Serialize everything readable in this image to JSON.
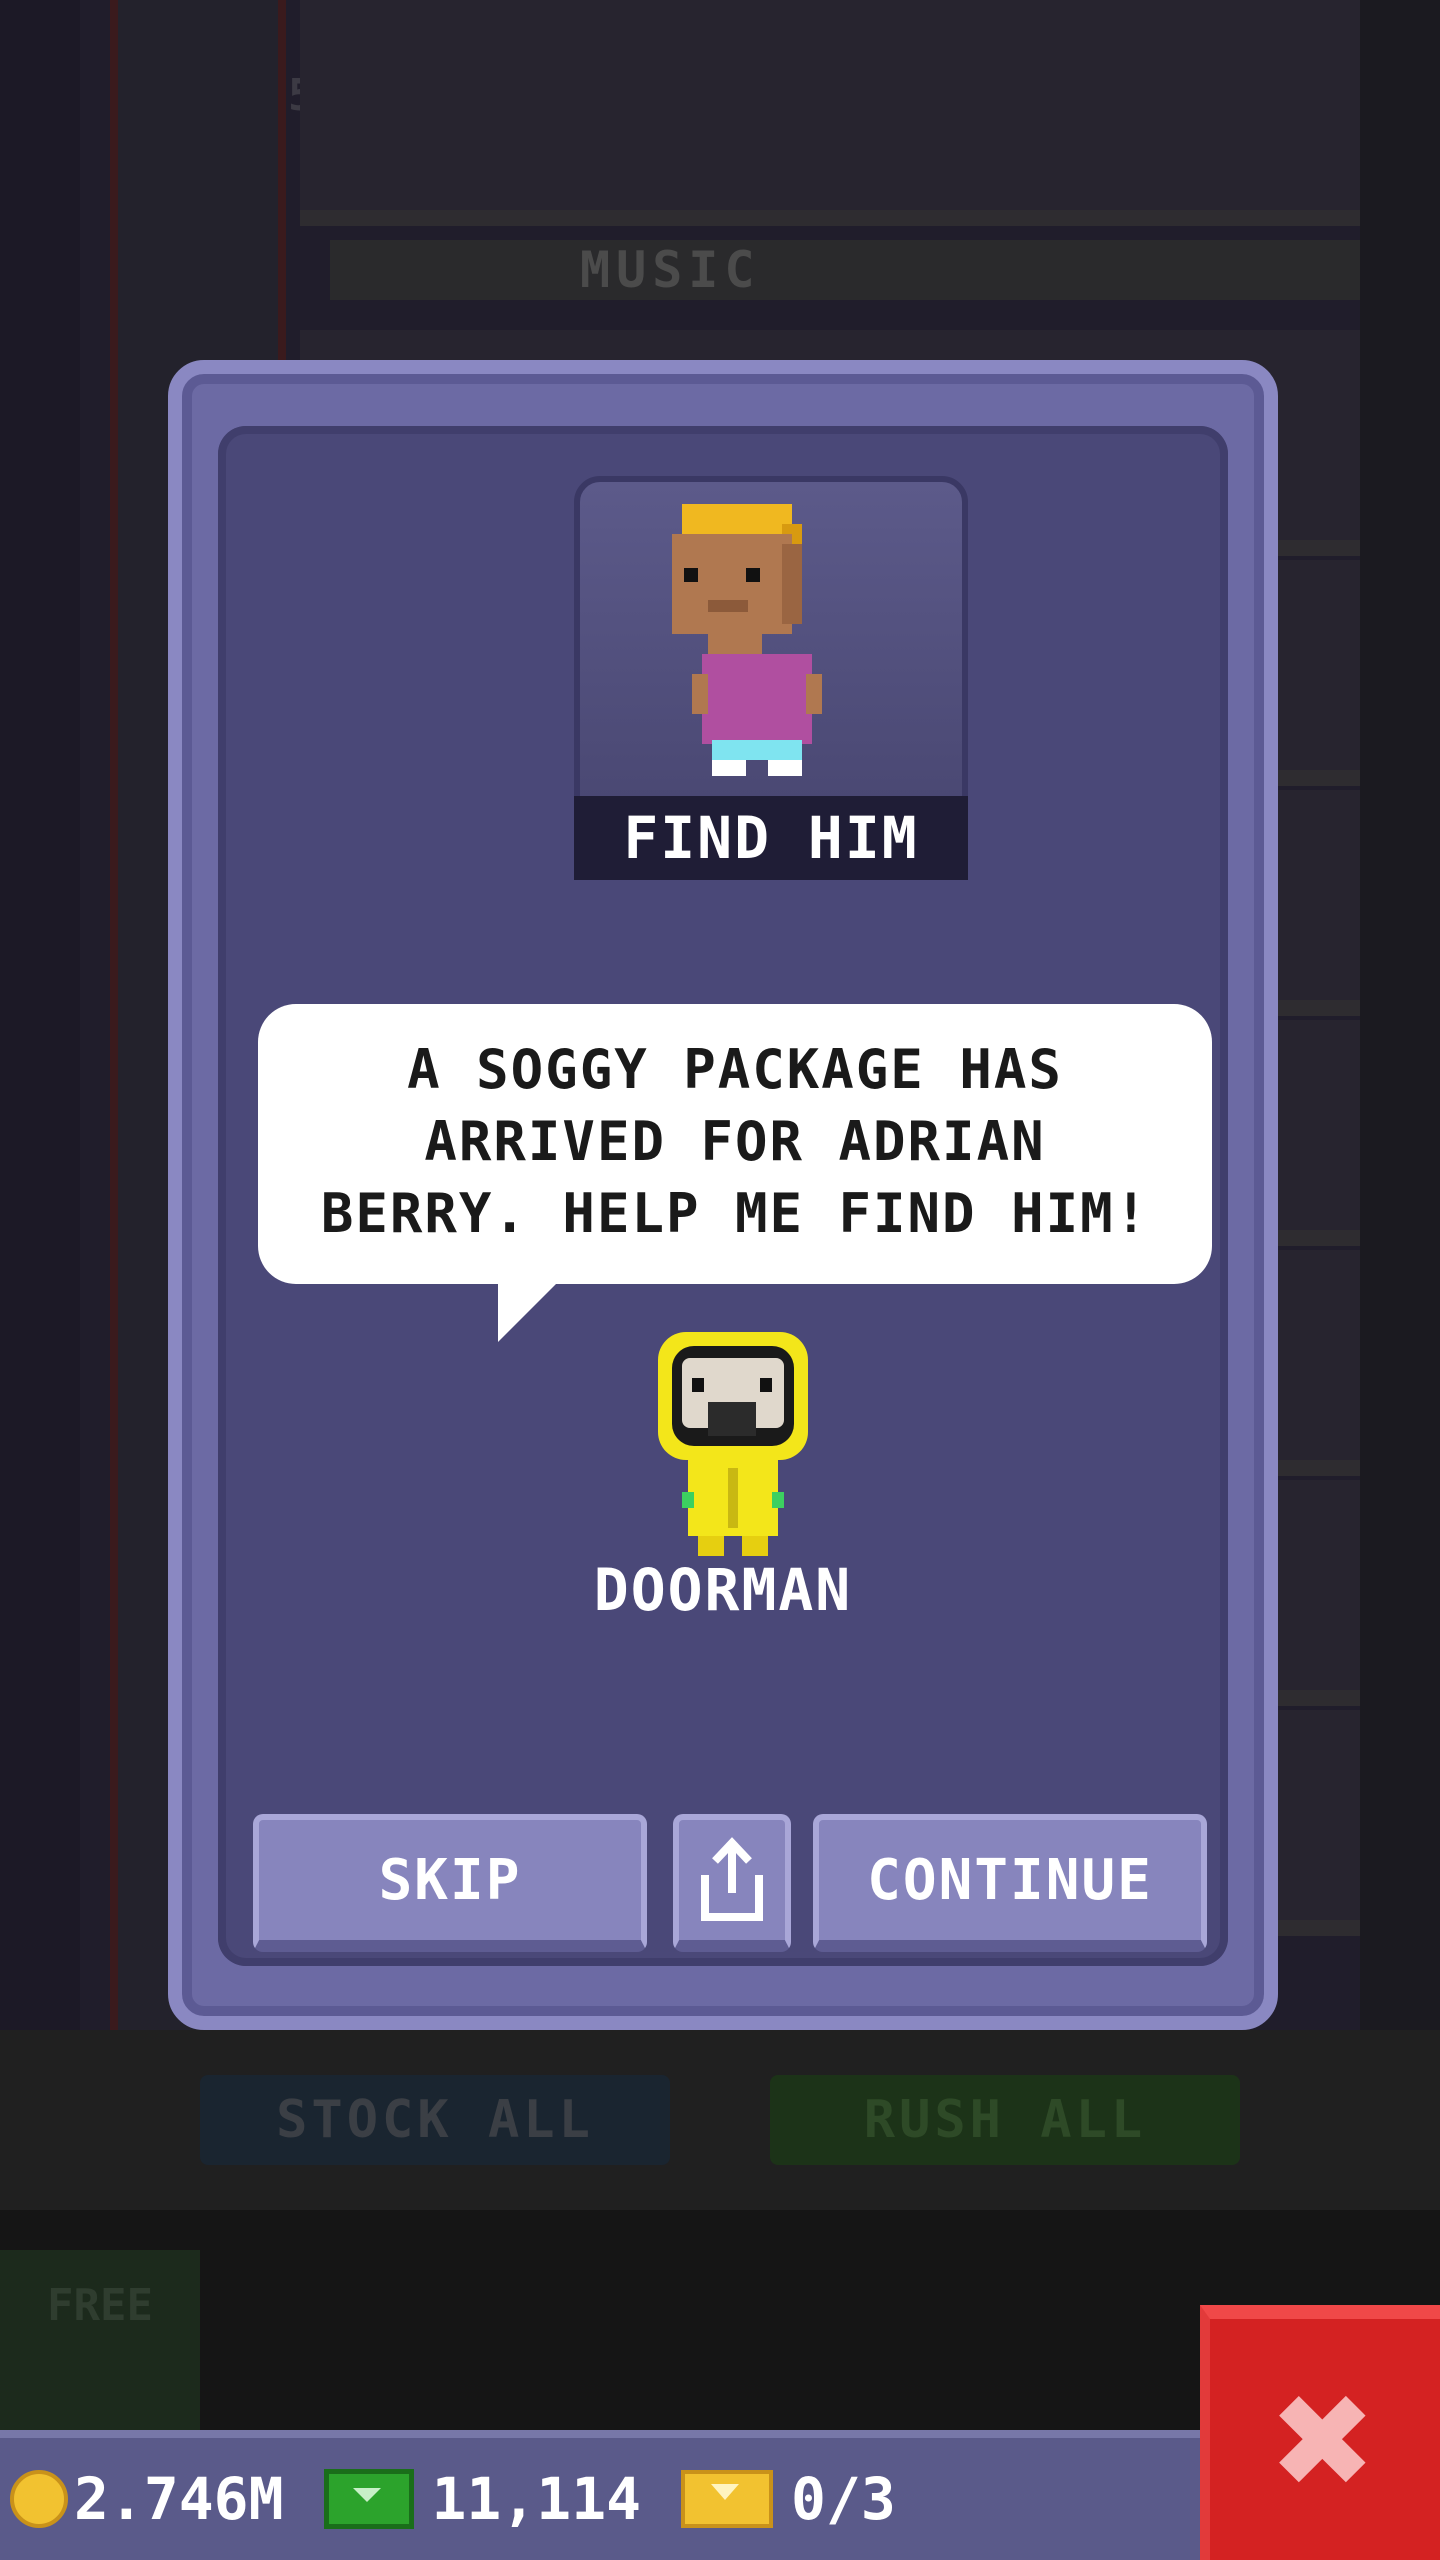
{
  "background": {
    "floor_number": "5",
    "floor_label": "MUSIC",
    "stock_all_label": "STOCK ALL",
    "rush_all_label": "RUSH ALL",
    "free_label": "FREE"
  },
  "dialog": {
    "portrait_label": "FIND HIM",
    "speech_text": "A SOGGY PACKAGE HAS ARRIVED FOR ADRIAN BERRY. HELP ME FIND HIM!",
    "speaker_name": "DOORMAN",
    "skip_label": "SKIP",
    "continue_label": "CONTINUE"
  },
  "status": {
    "coins": "2.746M",
    "bux": "11,114",
    "tickets": "0/3"
  },
  "icons": [
    "coin-icon",
    "bux-icon",
    "ticket-icon",
    "share-icon",
    "close-icon"
  ],
  "colors": {
    "dialog_bg": "#4a4878",
    "button": "#8785bd",
    "close": "#d42222"
  }
}
